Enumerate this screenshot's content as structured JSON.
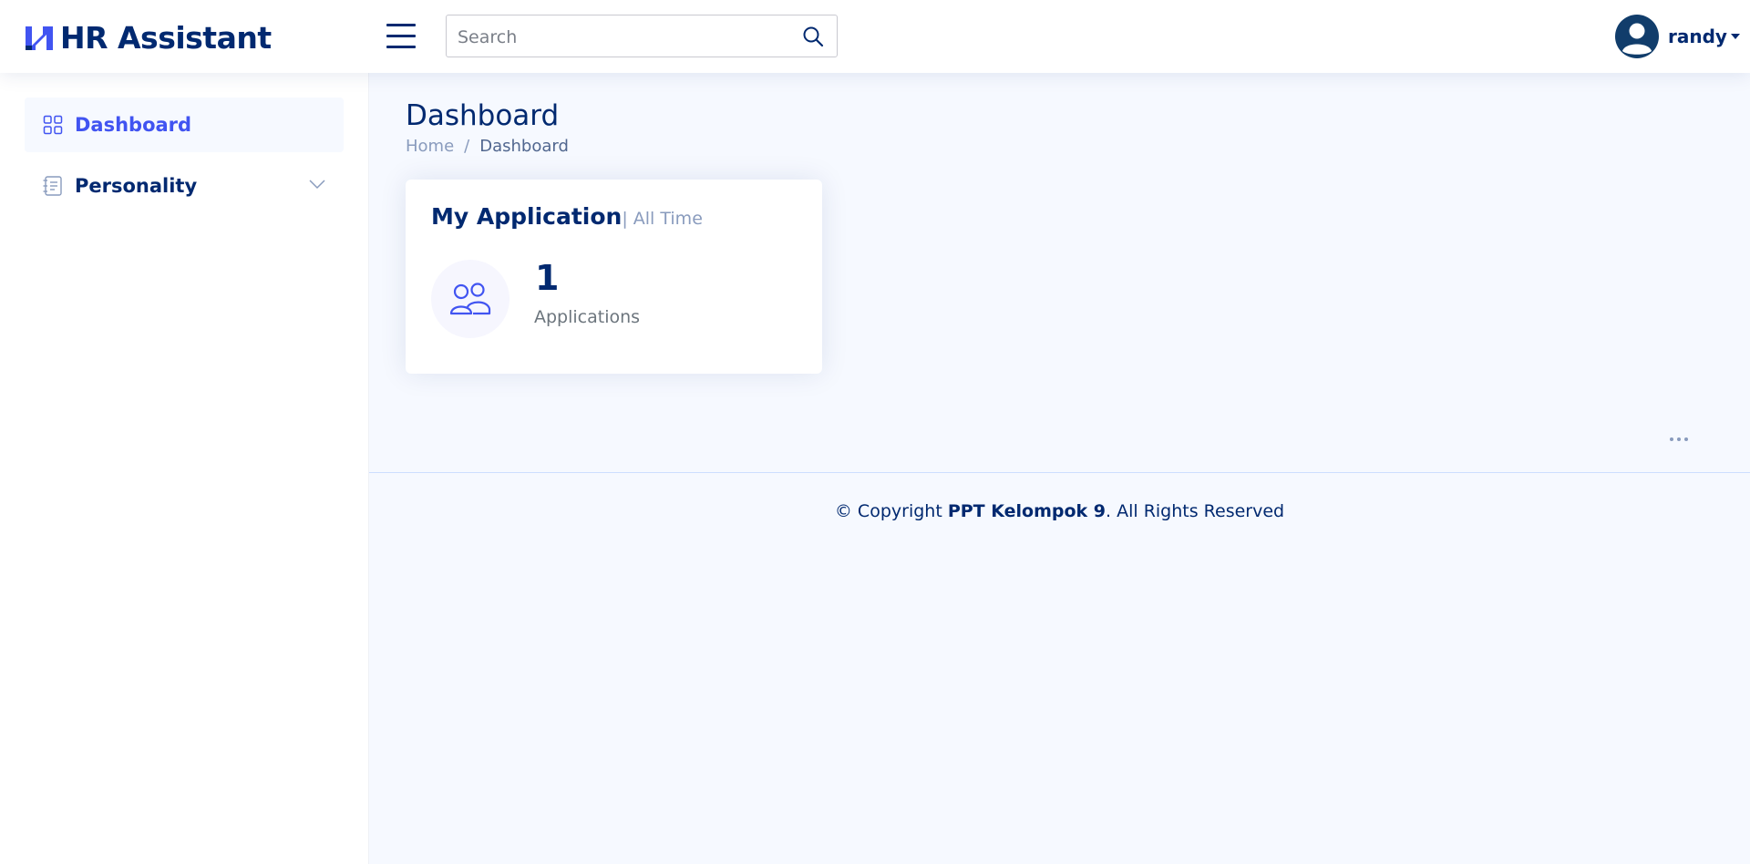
{
  "header": {
    "app_title": "HR Assistant",
    "search_placeholder": "Search",
    "search_value": "",
    "username": "randy"
  },
  "sidebar": {
    "items": [
      {
        "label": "Dashboard",
        "icon": "grid-icon",
        "active": true
      },
      {
        "label": "Personality",
        "icon": "journal-text-icon",
        "expandable": true
      }
    ]
  },
  "main": {
    "page_title": "Dashboard",
    "breadcrumb": {
      "home": "Home",
      "separator": "/",
      "current": "Dashboard"
    },
    "card": {
      "title": "My Application",
      "subtitle": "| All Time",
      "value": "1",
      "label": "Applications",
      "icon": "people-icon"
    }
  },
  "footer": {
    "prefix": "© Copyright",
    "company": "PPT Kelompok 9",
    "suffix": ". All Rights Reserved"
  },
  "colors": {
    "primary": "#012970",
    "accent": "#4154f1",
    "background": "#f6f9ff",
    "muted": "#899bbd"
  }
}
